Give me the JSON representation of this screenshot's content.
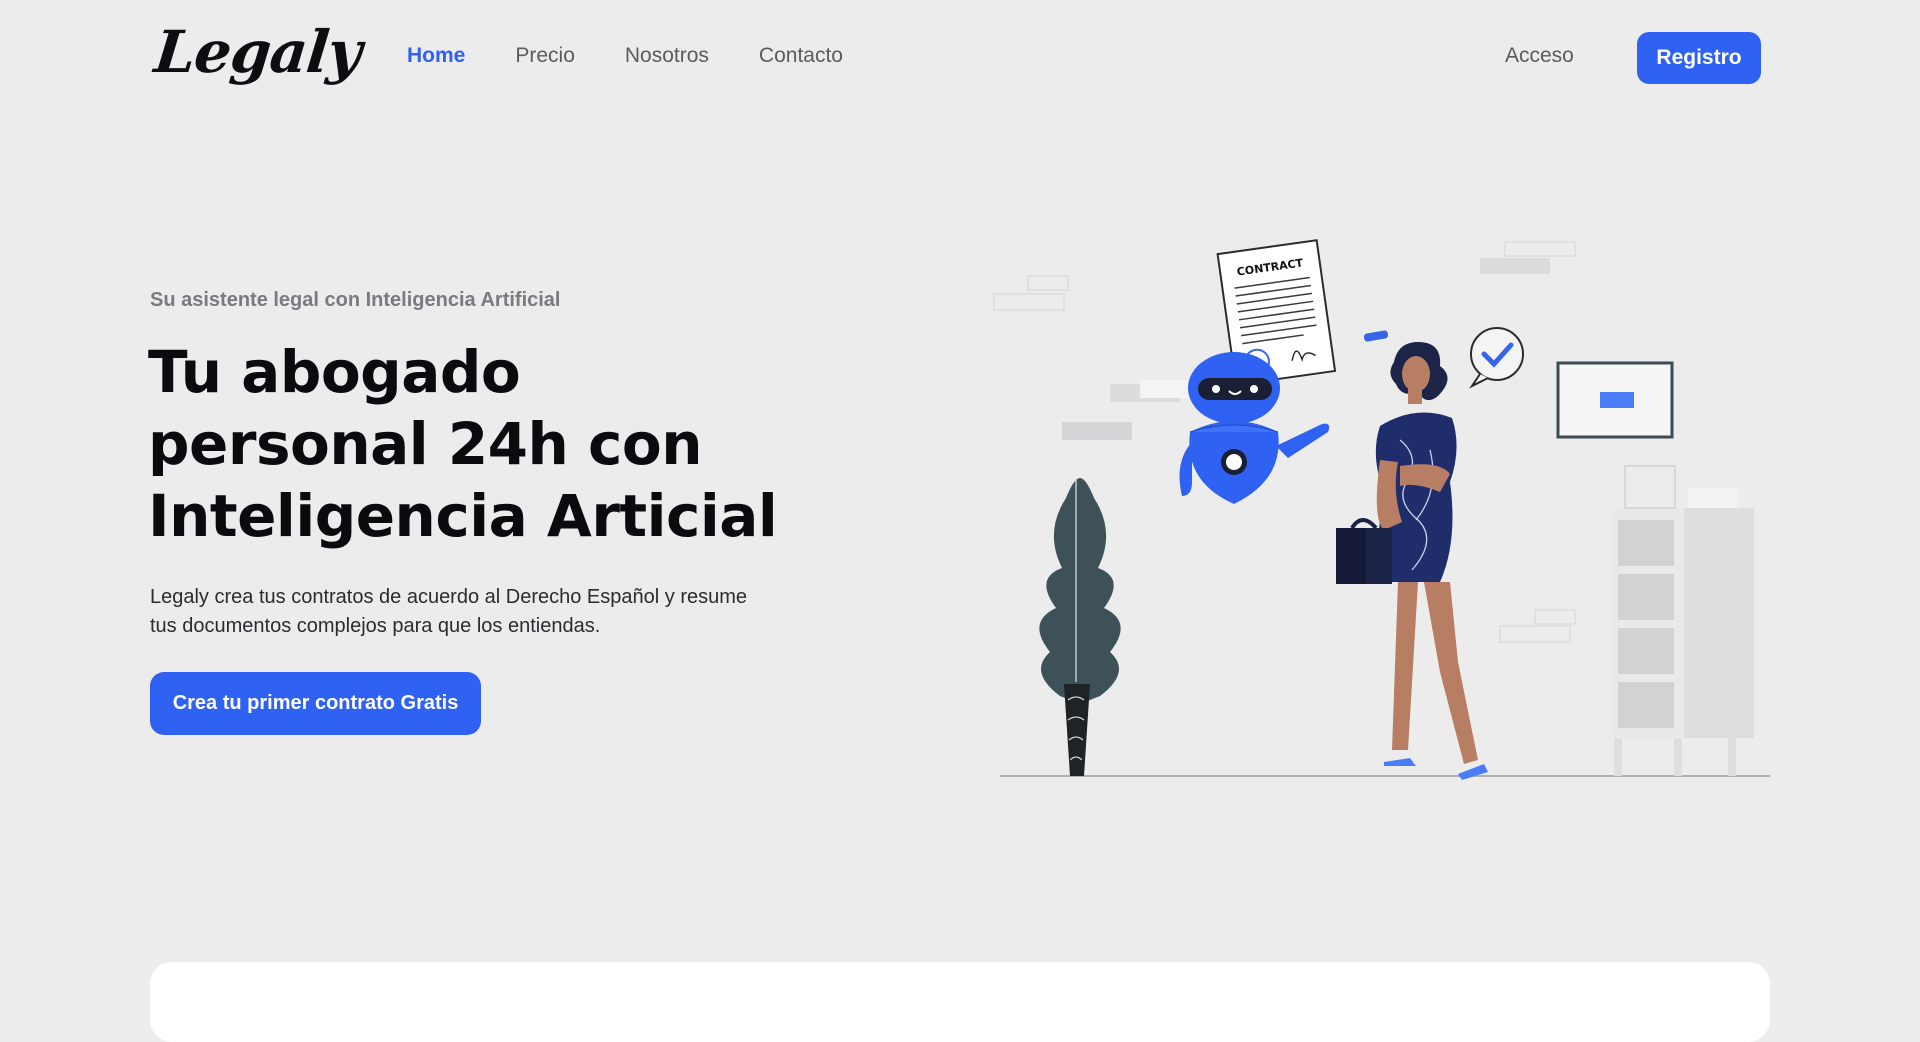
{
  "brand": {
    "logo_text": "Legaly"
  },
  "nav": {
    "links": [
      {
        "label": "Home",
        "active": true
      },
      {
        "label": "Precio",
        "active": false
      },
      {
        "label": "Nosotros",
        "active": false
      },
      {
        "label": "Contacto",
        "active": false
      }
    ],
    "login_label": "Acceso",
    "register_label": "Registro"
  },
  "hero": {
    "eyebrow": "Su asistente legal con Inteligencia Artificial",
    "headline_line1": "Tu abogado",
    "headline_line2": "personal 24h con",
    "headline_line3": "Inteligencia Articial",
    "description_line1": "Legaly crea tus contratos de acuerdo al Derecho Español y resume",
    "description_line2": "tus documentos complejos para que los entiendas.",
    "cta_label": "Crea tu primer contrato Gratis"
  },
  "illustration": {
    "contract_label": "CONTRACT"
  },
  "colors": {
    "background": "#ececed",
    "accent": "#2f62f2",
    "dark_navy": "#1f2d6b",
    "plant": "#3f5158"
  }
}
